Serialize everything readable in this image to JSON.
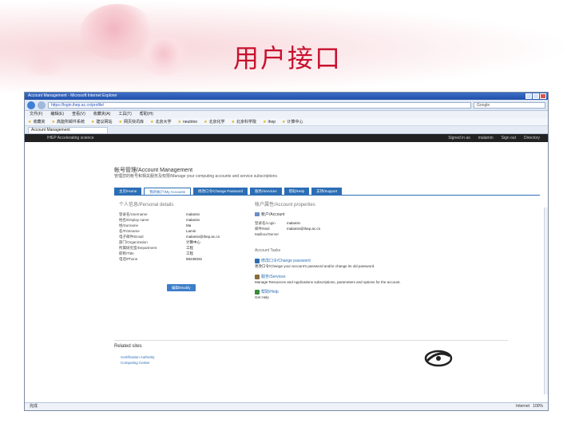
{
  "slide": {
    "title": "用户接口"
  },
  "browser": {
    "window_title": "Account Management - Microsoft Internet Explorer",
    "url": "https://login.ihep.ac.cn/profile/",
    "search_placeholder": "Google",
    "menu": [
      "文件(F)",
      "编辑(E)",
      "查看(V)",
      "收藏夹(A)",
      "工具(T)",
      "帮助(H)"
    ],
    "favorites": [
      "收藏夹",
      "高能所邮件系统",
      "建议网站",
      "网页快讯库",
      "北京大学",
      "neutrino",
      "北京化学",
      "北京科学院",
      "ihep",
      "计算中心"
    ],
    "tab_title": "Account Management",
    "status_left": "完成",
    "status_right": "Internet",
    "zoom": "100%"
  },
  "site": {
    "brand": "IHEP Accelerating science",
    "signed_in_label": "Signed in as",
    "user": "malamin",
    "signout": "Sign out",
    "directory": "Directory"
  },
  "page": {
    "heading": "帐号管理/Account Management",
    "subheading": "管理您的帐号和相关服务及权限/Manage your computing accounts and service subscriptions",
    "tabs": [
      "主页/Home",
      "我的帐户/My Accounts",
      "修改口令/Change Password",
      "服务/Services",
      "帮助/Help",
      "支持/Support"
    ],
    "personal_header": "个人信息/Personal details",
    "personal": [
      {
        "k": "登录名/Username",
        "v": "malamin"
      },
      {
        "k": "姓名/Display name",
        "v": "malamin"
      },
      {
        "k": "姓/Surname",
        "v": "Ma"
      },
      {
        "k": "名/Firstname",
        "v": "Lamin"
      },
      {
        "k": "电子邮件/Email",
        "v": "malamin@ihep.ac.cn"
      },
      {
        "k": "部门/Organization",
        "v": "计算中心"
      },
      {
        "k": "所属研究室/Department",
        "v": "工程"
      },
      {
        "k": "职称/Title",
        "v": "工程"
      },
      {
        "k": "电话/Phone",
        "v": "88236032"
      }
    ],
    "edit_button": "编辑/Modify",
    "account_header": "帐户属性/Account properties",
    "account_name_label": "帐户/Account",
    "account": [
      {
        "k": "登录名/Login",
        "v": "malamin"
      },
      {
        "k": "邮件/Mail",
        "v": "malamin@ihep.ac.cn"
      },
      {
        "k": "Mailbox/Server",
        "v": ""
      }
    ],
    "tasks_header": "Account Tasks",
    "tasks": [
      {
        "title": "修改口令/Change password",
        "desc": "更改口令/Change your account's password and/or change its old password.",
        "icon": "key-icon",
        "color": "#2c6eb5"
      },
      {
        "title": "服务/Services",
        "desc": "Manage Resources and Applications subscriptions, parameters and options for the account.",
        "icon": "tools-icon",
        "color": "#8a6d3b"
      },
      {
        "title": "帮助/Help",
        "desc": "Get Help",
        "icon": "help-icon",
        "color": "#3a8c3a"
      }
    ],
    "related_header": "Related sites",
    "related": [
      "Certification Authority",
      "Computing Center"
    ]
  }
}
